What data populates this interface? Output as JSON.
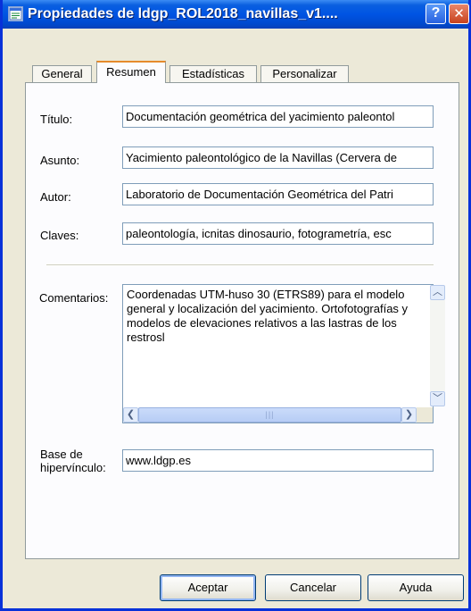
{
  "window": {
    "title": "Propiedades de ldgp_ROL2018_navillas_v1....",
    "help_label": "?",
    "close_label": "✕"
  },
  "tabs": [
    {
      "label": "General",
      "active": false
    },
    {
      "label": "Resumen",
      "active": true
    },
    {
      "label": "Estadísticas",
      "active": false
    },
    {
      "label": "Personalizar",
      "active": false
    }
  ],
  "fields": {
    "titulo": {
      "label": "Título:",
      "value": "Documentación geométrica del yacimiento paleontol"
    },
    "asunto": {
      "label": "Asunto:",
      "value": "Yacimiento paleontológico de la Navillas (Cervera de"
    },
    "autor": {
      "label": "Autor:",
      "value": "Laboratorio de Documentación Geométrica del Patri"
    },
    "claves": {
      "label": "Claves:",
      "value": "paleontología, icnitas dinosaurio, fotogrametría, esc"
    },
    "comentarios": {
      "label": "Comentarios:",
      "value": "Coordenadas UTM-huso 30 (ETRS89) para el modelo general y localización del yacimiento. Ortofotografías y modelos de elevaciones relativos a las lastras de los restrosl"
    },
    "hipervinculo": {
      "label_line1": "Base de",
      "label_line2": "hipervínculo:",
      "value": "www.ldgp.es"
    }
  },
  "scrollbar": {
    "up": "︿",
    "down": "﹀",
    "left": "❮",
    "right": "❯",
    "grip": "|||"
  },
  "buttons": {
    "accept": "Aceptar",
    "cancel": "Cancelar",
    "help": "Ayuda"
  },
  "icons": {
    "app": "document-properties-icon"
  }
}
